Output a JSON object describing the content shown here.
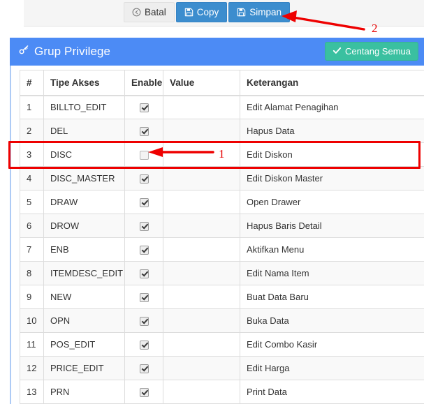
{
  "toolbar": {
    "buttons": [
      {
        "label": "Batal",
        "icon": "back-circle-icon",
        "style": "default"
      },
      {
        "label": "Copy",
        "icon": "save-disk-icon",
        "style": "primary"
      },
      {
        "label": "Simpan",
        "icon": "save-disk-icon",
        "style": "primary"
      }
    ]
  },
  "panel": {
    "title": "Grup Privilege",
    "title_icon": "key-icon",
    "check_all_label": "Centang Semua",
    "check_all_icon": "check-icon",
    "header_color": "#4c8bf5",
    "check_all_color": "#3ac0a0"
  },
  "table": {
    "headers": [
      "#",
      "Tipe Akses",
      "Enable",
      "Value",
      "Keterangan"
    ],
    "rows": [
      {
        "no": "1",
        "tipe": "BILLTO_EDIT",
        "enable": true,
        "value": "",
        "keterangan": "Edit Alamat Penagihan",
        "highlight": false
      },
      {
        "no": "2",
        "tipe": "DEL",
        "enable": true,
        "value": "",
        "keterangan": "Hapus Data",
        "highlight": false
      },
      {
        "no": "3",
        "tipe": "DISC",
        "enable": false,
        "value": "",
        "keterangan": "Edit Diskon",
        "highlight": true
      },
      {
        "no": "4",
        "tipe": "DISC_MASTER",
        "enable": true,
        "value": "",
        "keterangan": "Edit Diskon Master",
        "highlight": false
      },
      {
        "no": "5",
        "tipe": "DRAW",
        "enable": true,
        "value": "",
        "keterangan": "Open Drawer",
        "highlight": false
      },
      {
        "no": "6",
        "tipe": "DROW",
        "enable": true,
        "value": "",
        "keterangan": "Hapus Baris Detail",
        "highlight": false
      },
      {
        "no": "7",
        "tipe": "ENB",
        "enable": true,
        "value": "",
        "keterangan": "Aktifkan Menu",
        "highlight": false
      },
      {
        "no": "8",
        "tipe": "ITEMDESC_EDIT",
        "enable": true,
        "value": "",
        "keterangan": "Edit Nama Item",
        "highlight": false
      },
      {
        "no": "9",
        "tipe": "NEW",
        "enable": true,
        "value": "",
        "keterangan": "Buat Data Baru",
        "highlight": false
      },
      {
        "no": "10",
        "tipe": "OPN",
        "enable": true,
        "value": "",
        "keterangan": "Buka Data",
        "highlight": false
      },
      {
        "no": "11",
        "tipe": "POS_EDIT",
        "enable": true,
        "value": "",
        "keterangan": "Edit Combo Kasir",
        "highlight": false
      },
      {
        "no": "12",
        "tipe": "PRICE_EDIT",
        "enable": true,
        "value": "",
        "keterangan": "Edit Harga",
        "highlight": false
      },
      {
        "no": "13",
        "tipe": "PRN",
        "enable": true,
        "value": "",
        "keterangan": "Print Data",
        "highlight": false
      }
    ]
  },
  "annotations": {
    "color": "#ee0000",
    "marker_1": "1",
    "marker_2": "2"
  }
}
